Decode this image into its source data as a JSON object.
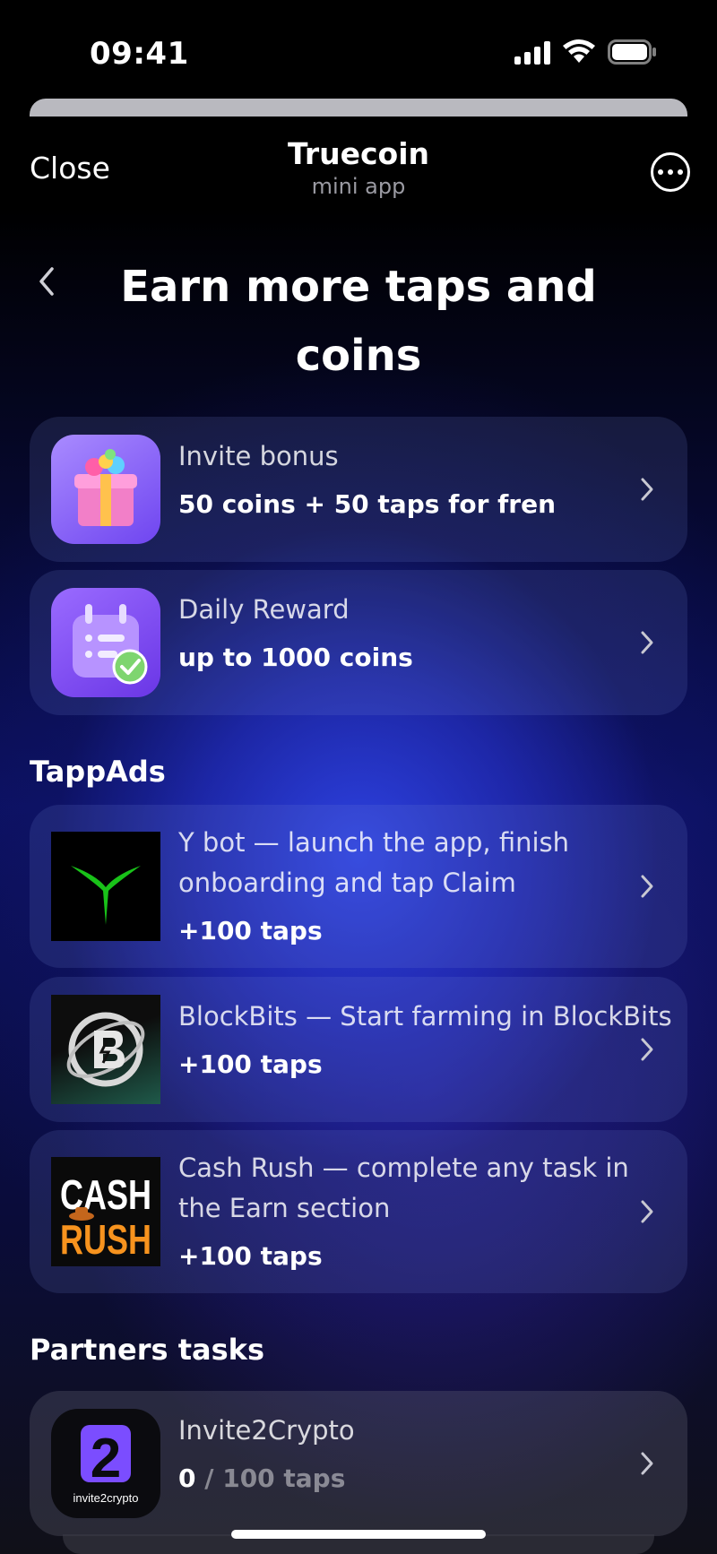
{
  "status_bar": {
    "time": "09:41"
  },
  "header": {
    "close_label": "Close",
    "app_title": "Truecoin",
    "app_subtitle": "mini app",
    "more_icon": "ellipsis-circle-icon"
  },
  "page": {
    "title": "Earn more taps and coins",
    "back_icon": "chevron-left-icon"
  },
  "bonus_cards": [
    {
      "title": "Invite bonus",
      "subtitle": "50 coins + 50 taps for fren",
      "icon": "gift-icon"
    },
    {
      "title": "Daily Reward",
      "subtitle": "up to 1000 coins",
      "icon": "calendar-check-icon"
    }
  ],
  "tappads": {
    "section_title": "TappAds",
    "items": [
      {
        "title": "Y bot — launch the app, finish onboarding and tap Claim",
        "reward": "+100 taps",
        "icon": "y-bot-logo"
      },
      {
        "title": "BlockBits — Start farming in BlockBits",
        "reward": "+100 taps",
        "icon": "blockbits-logo"
      },
      {
        "title": "Cash Rush — complete any task in the Earn section",
        "reward": "+100 taps",
        "icon": "cash-rush-logo",
        "logo_text_top": "CASH",
        "logo_text_bottom": "RUSH"
      }
    ]
  },
  "partners": {
    "section_title": "Partners tasks",
    "items": [
      {
        "title": "Invite2Crypto",
        "progress_current": "0",
        "progress_total": "/ 100 taps",
        "icon": "invite2crypto-logo",
        "logo_text": "invite2crypto",
        "logo_digit": "2"
      }
    ]
  },
  "colors": {
    "card_bg": "rgba(120,135,220,0.16)",
    "accent_purple": "#7b4dff",
    "y_bot_green": "#19c219",
    "cash_rush_orange": "#f7931e"
  }
}
